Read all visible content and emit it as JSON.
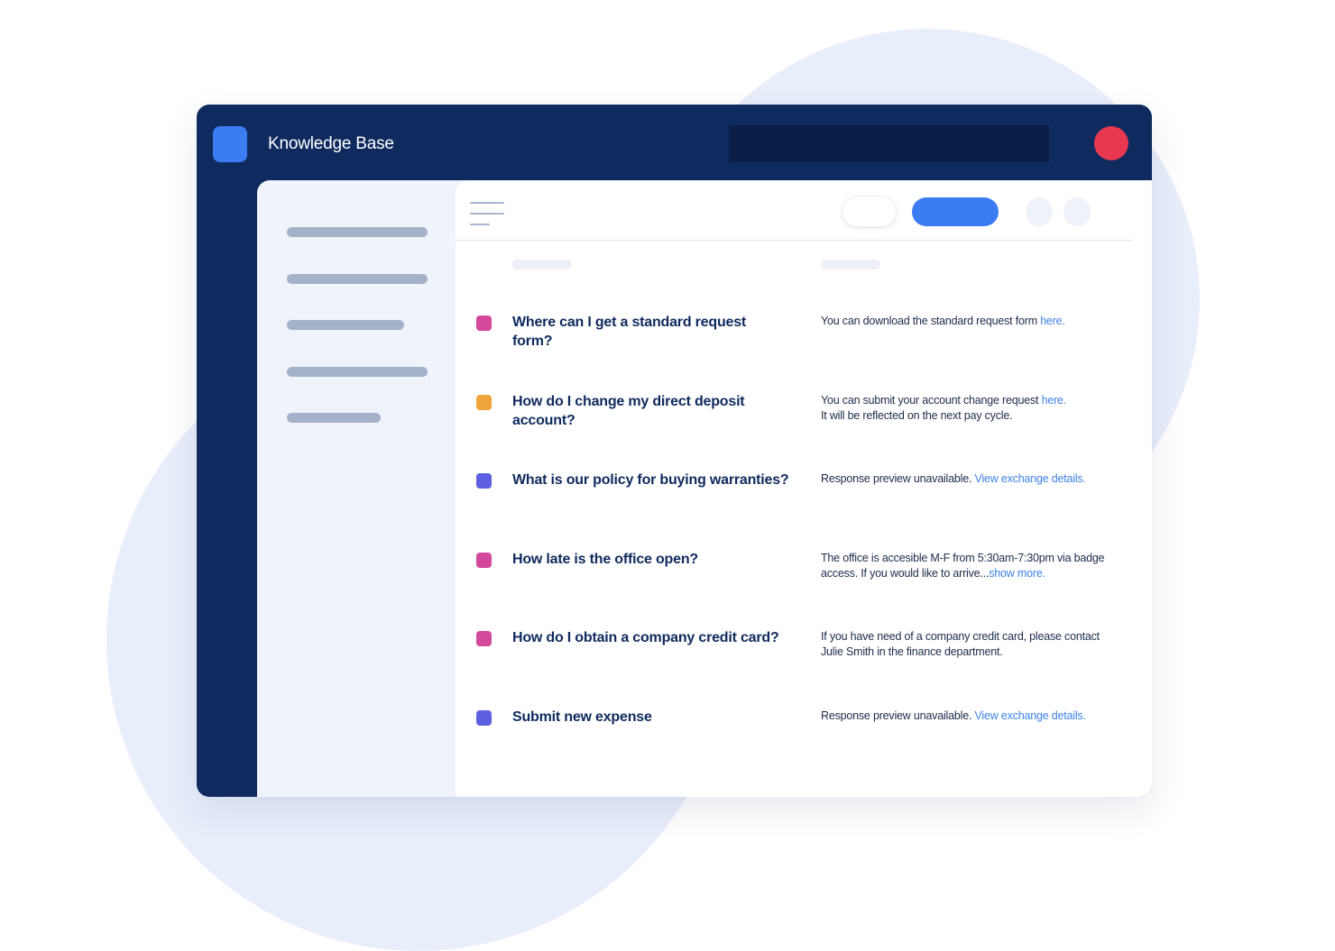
{
  "app": {
    "title": "Knowledge Base"
  },
  "colors": {
    "navy": "#0f2a5e",
    "accent_blue": "#3b7cf2",
    "avatar_red": "#e7384f",
    "pink": "#d3489a",
    "orange": "#f0a53a",
    "indigo": "#5b5fe0",
    "link": "#3d82ea"
  },
  "icons": {
    "menu": "hamburger-menu-icon"
  },
  "rows": [
    {
      "dot_color": "#d3489a",
      "question": "Where can I get a standard request form?",
      "answer_text": "You can download the standard request form ",
      "answer_link": "here."
    },
    {
      "dot_color": "#f0a53a",
      "question": "How do I change my direct deposit account?",
      "answer_text": "You can submit your account change request ",
      "answer_link": "here.",
      "answer_text2": "It will be reflected on the next pay cycle."
    },
    {
      "dot_color": "#5b5fe0",
      "question": "What is our policy for buying warranties?",
      "answer_text": "Response preview unavailable. ",
      "answer_link": "View exchange details."
    },
    {
      "dot_color": "#d3489a",
      "question": "How late is the office open?",
      "answer_text": "The office is accesible M-F from 5:30am-7:30pm via badge access. If you would like to arrive...",
      "answer_link": "show more."
    },
    {
      "dot_color": "#d3489a",
      "question": "How do I obtain a company credit card?",
      "answer_text": "If you have need of a company credit card, please contact Julie Smith in the finance department."
    },
    {
      "dot_color": "#5b5fe0",
      "question": "Submit new expense",
      "answer_text": "Response preview unavailable. ",
      "answer_link": "View exchange details."
    }
  ]
}
